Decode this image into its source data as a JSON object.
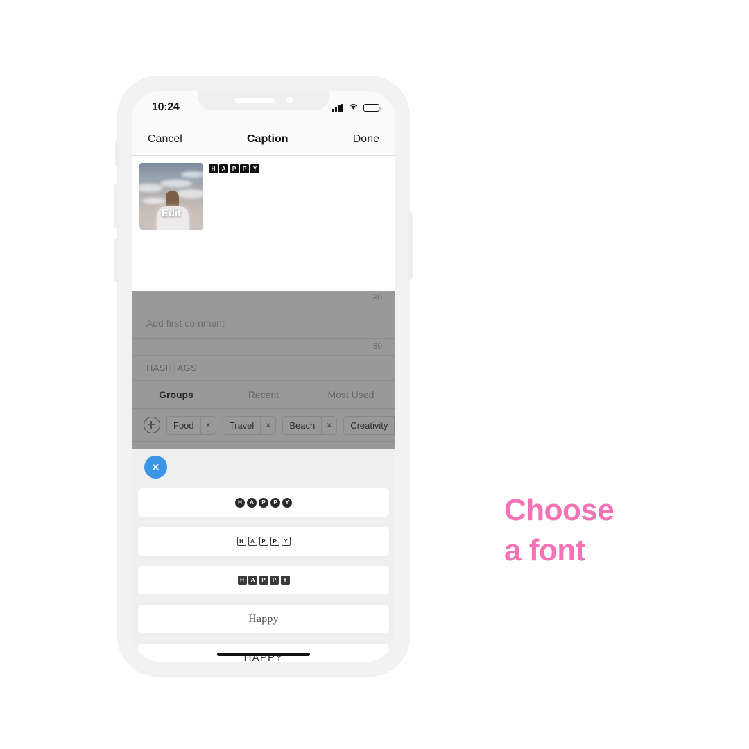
{
  "promo": {
    "line1": "Choose",
    "line2": "a font",
    "color": "#f472b6"
  },
  "phone": {
    "status_bar": {
      "time": "10:24",
      "signal_icon": "cellular-signal-icon",
      "wifi_icon": "wifi-icon",
      "battery_icon": "battery-icon"
    },
    "nav_bar": {
      "cancel_label": "Cancel",
      "title": "Caption",
      "done_label": "Done"
    },
    "caption": {
      "thumbnail_overlay_label": "Edit",
      "caption_letters": [
        "H",
        "A",
        "P",
        "P",
        "Y"
      ]
    },
    "counters": {
      "caption_counter": "30",
      "comment_counter": "30"
    },
    "comment": {
      "placeholder": "Add first comment"
    },
    "hashtags": {
      "section_label": "HASHTAGS",
      "tabs": [
        {
          "label": "Groups",
          "active": true
        },
        {
          "label": "Recent",
          "active": false
        },
        {
          "label": "Most Used",
          "active": false
        }
      ],
      "add_button_icon": "plus-circle-icon",
      "chips": [
        {
          "label": "Food",
          "remove_icon": "close-icon"
        },
        {
          "label": "Travel",
          "remove_icon": "close-icon"
        },
        {
          "label": "Beach",
          "remove_icon": "close-icon"
        },
        {
          "label": "Creativity",
          "remove_icon": "close-icon"
        }
      ]
    },
    "font_sheet": {
      "close_icon": "close-icon",
      "close_button_color": "#3b96e8",
      "options": [
        {
          "style": "circle",
          "letters": [
            "H",
            "A",
            "P",
            "P",
            "Y"
          ],
          "preview": "HAPPY"
        },
        {
          "style": "outline",
          "letters": [
            "H",
            "A",
            "P",
            "P",
            "Y"
          ],
          "preview": "HAPPY"
        },
        {
          "style": "square",
          "letters": [
            "H",
            "A",
            "P",
            "P",
            "Y"
          ],
          "preview": "HAPPY"
        },
        {
          "style": "double",
          "preview": "Happy"
        },
        {
          "style": "plain",
          "preview": "HAPPY"
        }
      ]
    }
  }
}
